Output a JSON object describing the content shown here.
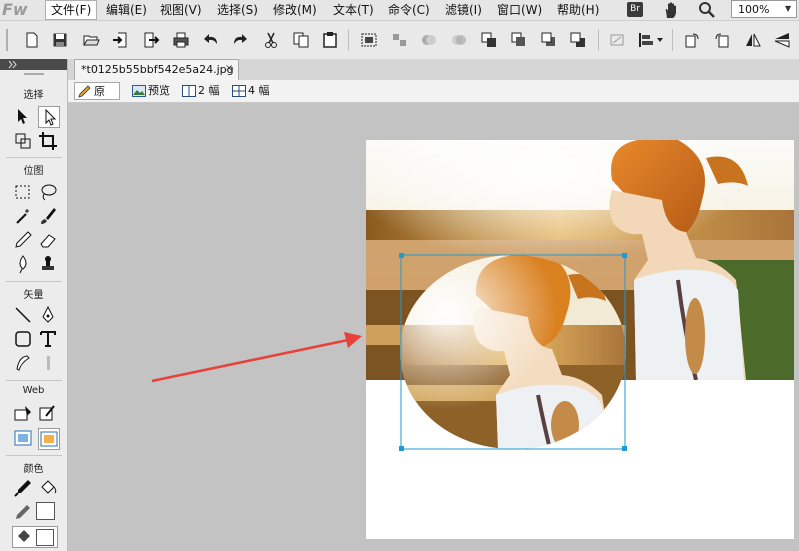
{
  "app": {
    "logo_text": "Fw"
  },
  "menu": {
    "items": [
      {
        "label": "文件(F)",
        "active": true
      },
      {
        "label": "编辑(E)"
      },
      {
        "label": "视图(V)"
      },
      {
        "label": "选择(S)"
      },
      {
        "label": "修改(M)"
      },
      {
        "label": "文本(T)"
      },
      {
        "label": "命令(C)"
      },
      {
        "label": "滤镜(I)"
      },
      {
        "label": "窗口(W)"
      },
      {
        "label": "帮助(H)"
      }
    ],
    "bridge_label": "Br",
    "zoom_value": "100%"
  },
  "tools_panel": {
    "sections": {
      "select": "选择",
      "bitmap": "位图",
      "vector": "矢量",
      "web": "Web",
      "colors": "颜色"
    }
  },
  "document": {
    "tab_title": "*t0125b55bbf542e5a24.jpg",
    "close_symbol": "×"
  },
  "view_modes": {
    "original": "原始",
    "preview": "预览",
    "two_up": "2 幅",
    "four_up": "4 幅"
  },
  "colors": {
    "selection": "#1e9ad6",
    "arrow": "#e8413a",
    "toolbar_bg": "#e9e9e9",
    "canvas_bg": "#c3c3c3"
  },
  "icons": [
    "new-icon",
    "save-icon",
    "open-icon",
    "import-icon",
    "export-icon",
    "print-icon",
    "undo-icon",
    "redo-icon",
    "cut-icon",
    "copy-icon",
    "paste-icon",
    "group-icon",
    "ungroup-icon",
    "join-icon",
    "split-icon",
    "bring-front-icon",
    "bring-forward-icon",
    "send-backward-icon",
    "send-back-icon",
    "align-icon",
    "rotate-icon",
    "flip-icon",
    "hand-icon",
    "zoom-icon"
  ]
}
